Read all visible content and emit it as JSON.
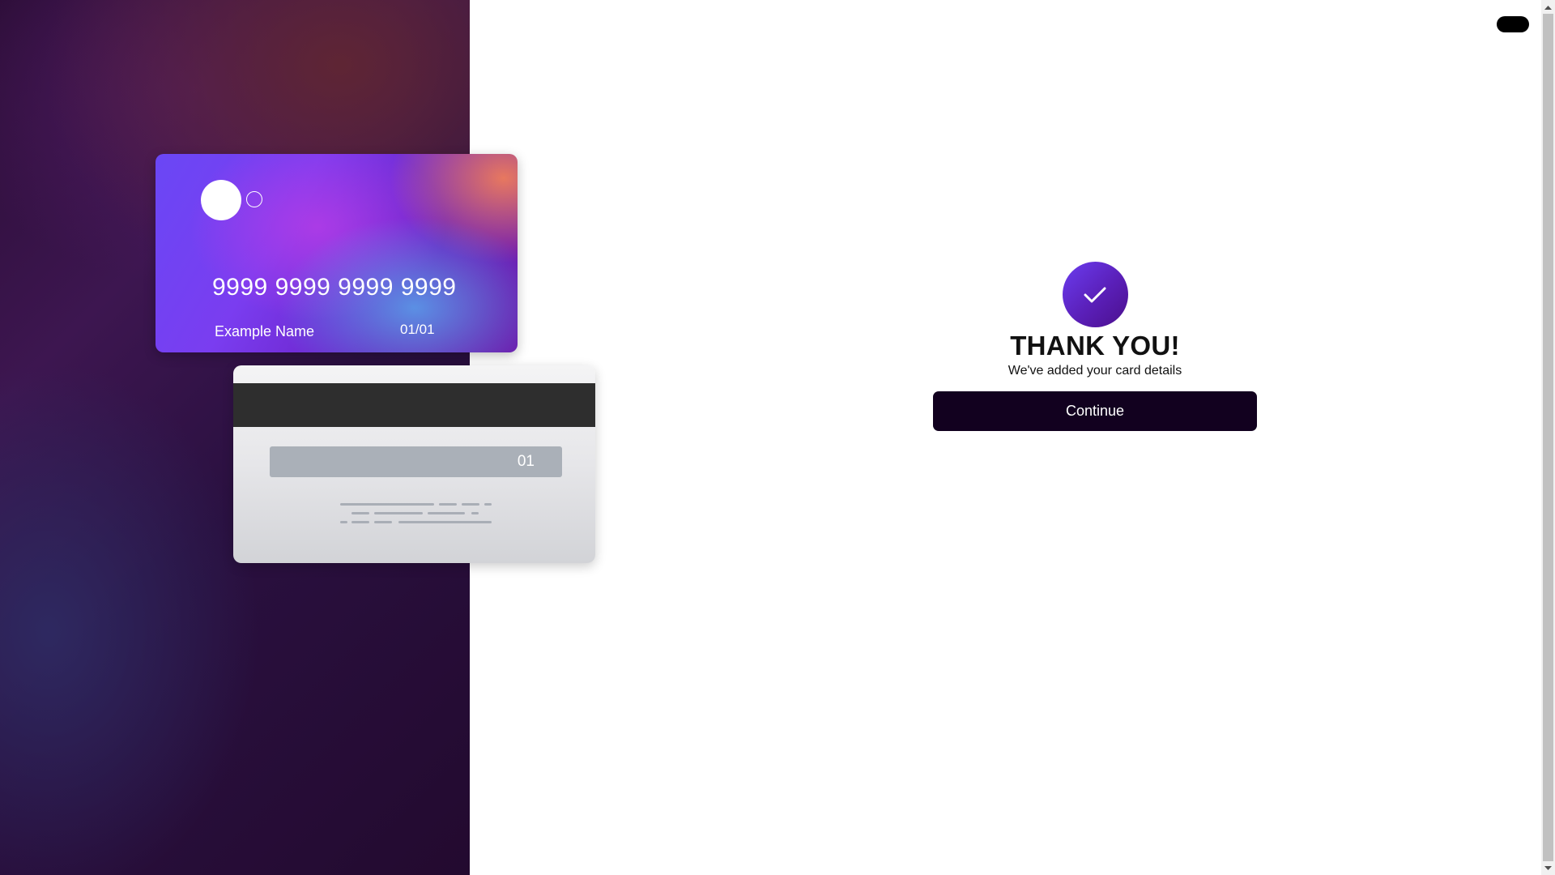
{
  "card_front": {
    "number": "9999 9999 9999 9999",
    "name": "Example Name",
    "expiry": "01/01"
  },
  "card_back": {
    "cvc": "01"
  },
  "confirmation": {
    "title": "THANK YOU!",
    "subtitle": "We've added your card details",
    "continue_label": "Continue"
  },
  "colors": {
    "accent": "#6b3df0",
    "button_bg": "#12011f",
    "panel_bg": "#2a1040"
  },
  "icons": {
    "success": "check-icon",
    "toggle": "toggle-pill"
  }
}
